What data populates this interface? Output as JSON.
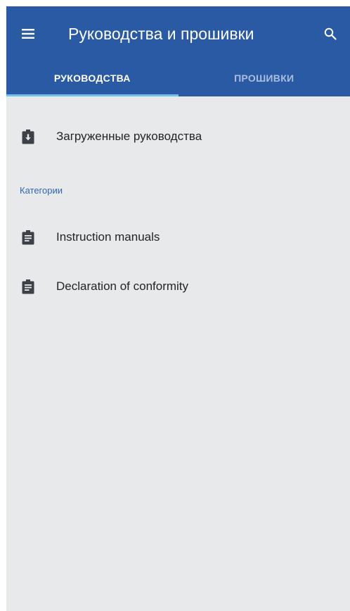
{
  "app_bar": {
    "title": "Руководства и прошивки",
    "menu_icon": "hamburger-menu-icon",
    "search_icon": "search-icon",
    "background_color": "#2a5aa3"
  },
  "tabs": [
    {
      "label": "РУКОВОДСТВА",
      "selected": true
    },
    {
      "label": "ПРОШИВКИ",
      "selected": false
    }
  ],
  "downloaded_item": {
    "label": "Загруженные руководства",
    "icon": "clipboard-download-icon"
  },
  "categories": {
    "header": "Категории",
    "header_color": "#2e66b8",
    "items": [
      {
        "label": "Instruction manuals",
        "icon": "clipboard-text-icon"
      },
      {
        "label": "Declaration of conformity",
        "icon": "clipboard-text-icon"
      }
    ]
  }
}
